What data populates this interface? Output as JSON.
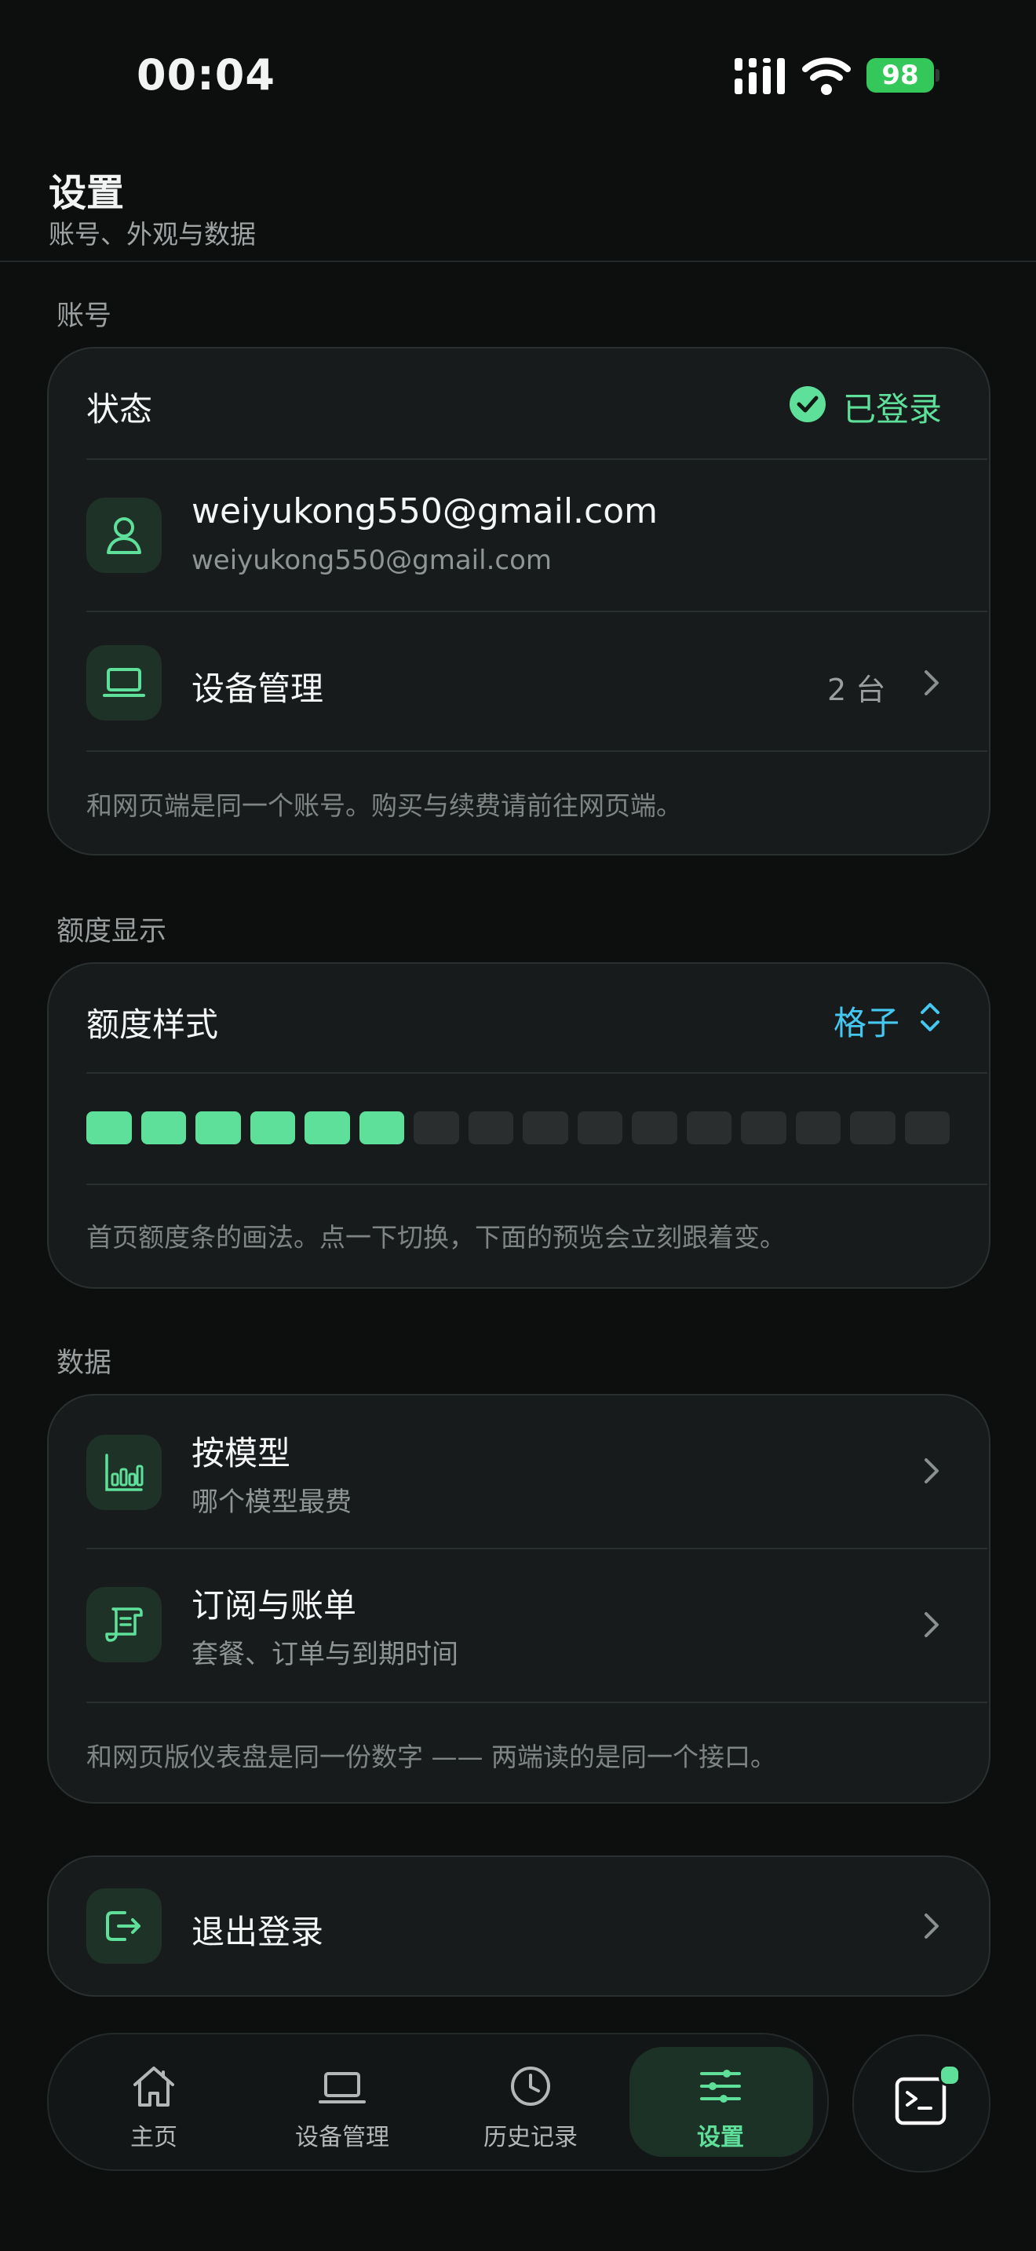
{
  "status_bar": {
    "time": "00:04",
    "battery": "98"
  },
  "header": {
    "title": "设置",
    "subtitle": "账号、外观与数据"
  },
  "account": {
    "section_label": "账号",
    "status_label": "状态",
    "status_value": "已登录",
    "email_title": "weiyukong550@gmail.com",
    "email_sub": "weiyukong550@gmail.com",
    "devices_label": "设备管理",
    "devices_count": "2 台",
    "note": "和网页端是同一个账号。购买与续费请前往网页端。"
  },
  "quota": {
    "section_label": "额度显示",
    "style_label": "额度样式",
    "style_value": "格子",
    "segments_total": 16,
    "segments_filled": 6,
    "note": "首页额度条的画法。点一下切换，下面的预览会立刻跟着变。"
  },
  "data_section": {
    "section_label": "数据",
    "by_model_title": "按模型",
    "by_model_sub": "哪个模型最费",
    "billing_title": "订阅与账单",
    "billing_sub": "套餐、订单与到期时间",
    "note": "和网页版仪表盘是同一份数字 —— 两端读的是同一个接口。"
  },
  "logout": {
    "label": "退出登录"
  },
  "tabbar": {
    "tabs": [
      {
        "label": "主页",
        "icon": "home-icon"
      },
      {
        "label": "设备管理",
        "icon": "laptop-icon"
      },
      {
        "label": "历史记录",
        "icon": "clock-icon"
      },
      {
        "label": "设置",
        "icon": "sliders-icon"
      }
    ],
    "active_index": 3
  },
  "colors": {
    "accent_green": "#5fe09a",
    "accent_blue": "#45c8f0",
    "background": "#0d0f0f",
    "card": "#181b1c"
  }
}
